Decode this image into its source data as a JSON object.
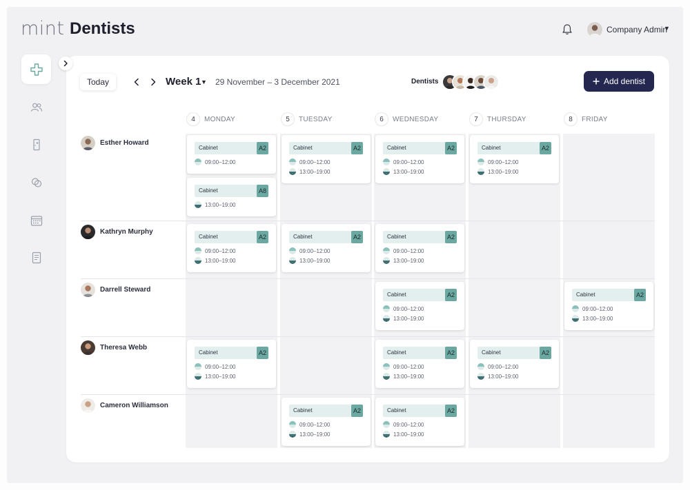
{
  "app": {
    "logo": "mint",
    "title": "Dentists",
    "user": {
      "name": "Company Admin"
    }
  },
  "sidebar": {
    "icons": [
      "dentist-icon",
      "patients-icon",
      "doors-icon",
      "links-icon",
      "calendar-icon",
      "document-icon"
    ]
  },
  "toolbar": {
    "today_label": "Today",
    "week_label": "Week 1",
    "date_range": "29 November – 3 December 2021",
    "dentists_label": "Dentists",
    "add_label": "Add dentist"
  },
  "days": [
    {
      "num": "4",
      "name": "MONDAY"
    },
    {
      "num": "5",
      "name": "TUESDAY"
    },
    {
      "num": "6",
      "name": "WEDNESDAY"
    },
    {
      "num": "7",
      "name": "THURSDAY"
    },
    {
      "num": "8",
      "name": "FRIDAY"
    }
  ],
  "dentists": [
    {
      "name": "Esther Howard"
    },
    {
      "name": "Kathryn Murphy"
    },
    {
      "name": "Darrell Steward"
    },
    {
      "name": "Theresa Webb"
    },
    {
      "name": "Cameron Williamson"
    }
  ],
  "shifts": [
    {
      "dentist": 0,
      "day": 0,
      "cabinet": "Cabinet",
      "code": "A2",
      "slots": [
        "09:00–12:00"
      ]
    },
    {
      "dentist": 0,
      "day": 0,
      "cabinet": "Cabinet",
      "code": "A8",
      "slots": [
        "13:00–19:00"
      ]
    },
    {
      "dentist": 0,
      "day": 1,
      "cabinet": "Cabinet",
      "code": "A2",
      "slots": [
        "09:00–12:00",
        "13:00–19:00"
      ]
    },
    {
      "dentist": 0,
      "day": 2,
      "cabinet": "Cabinet",
      "code": "A2",
      "slots": [
        "09:00–12:00",
        "13:00–19:00"
      ]
    },
    {
      "dentist": 0,
      "day": 3,
      "cabinet": "Cabinet",
      "code": "A2",
      "slots": [
        "09:00–12:00",
        "13:00–19:00"
      ]
    },
    {
      "dentist": 1,
      "day": 0,
      "cabinet": "Cabinet",
      "code": "A2",
      "slots": [
        "09:00–12:00",
        "13:00–19:00"
      ]
    },
    {
      "dentist": 1,
      "day": 1,
      "cabinet": "Cabinet",
      "code": "A2",
      "slots": [
        "09:00–12:00",
        "13:00–19:00"
      ]
    },
    {
      "dentist": 1,
      "day": 2,
      "cabinet": "Cabinet",
      "code": "A2",
      "slots": [
        "09:00–12:00",
        "13:00–19:00"
      ]
    },
    {
      "dentist": 2,
      "day": 2,
      "cabinet": "Cabinet",
      "code": "A2",
      "slots": [
        "09:00–12:00",
        "13:00–19:00"
      ]
    },
    {
      "dentist": 2,
      "day": 4,
      "cabinet": "Cabinet",
      "code": "A2",
      "slots": [
        "09:00–12:00",
        "13:00–19:00"
      ]
    },
    {
      "dentist": 3,
      "day": 0,
      "cabinet": "Cabinet",
      "code": "A2",
      "slots": [
        "09:00–12:00",
        "13:00–19:00"
      ]
    },
    {
      "dentist": 3,
      "day": 2,
      "cabinet": "Cabinet",
      "code": "A2",
      "slots": [
        "09:00–12:00",
        "13:00–19:00"
      ]
    },
    {
      "dentist": 3,
      "day": 3,
      "cabinet": "Cabinet",
      "code": "A2",
      "slots": [
        "09:00–12:00",
        "13:00–19:00"
      ]
    },
    {
      "dentist": 4,
      "day": 1,
      "cabinet": "Cabinet",
      "code": "A2",
      "slots": [
        "09:00–12:00",
        "13:00–19:00"
      ]
    },
    {
      "dentist": 4,
      "day": 2,
      "cabinet": "Cabinet",
      "code": "A2",
      "slots": [
        "09:00–12:00",
        "13:00–19:00"
      ]
    }
  ],
  "colors": {
    "accent": "#242850",
    "teal": "#6aa8a1",
    "teal_light": "#e2efee",
    "slot_dark": "#3f6f73"
  }
}
